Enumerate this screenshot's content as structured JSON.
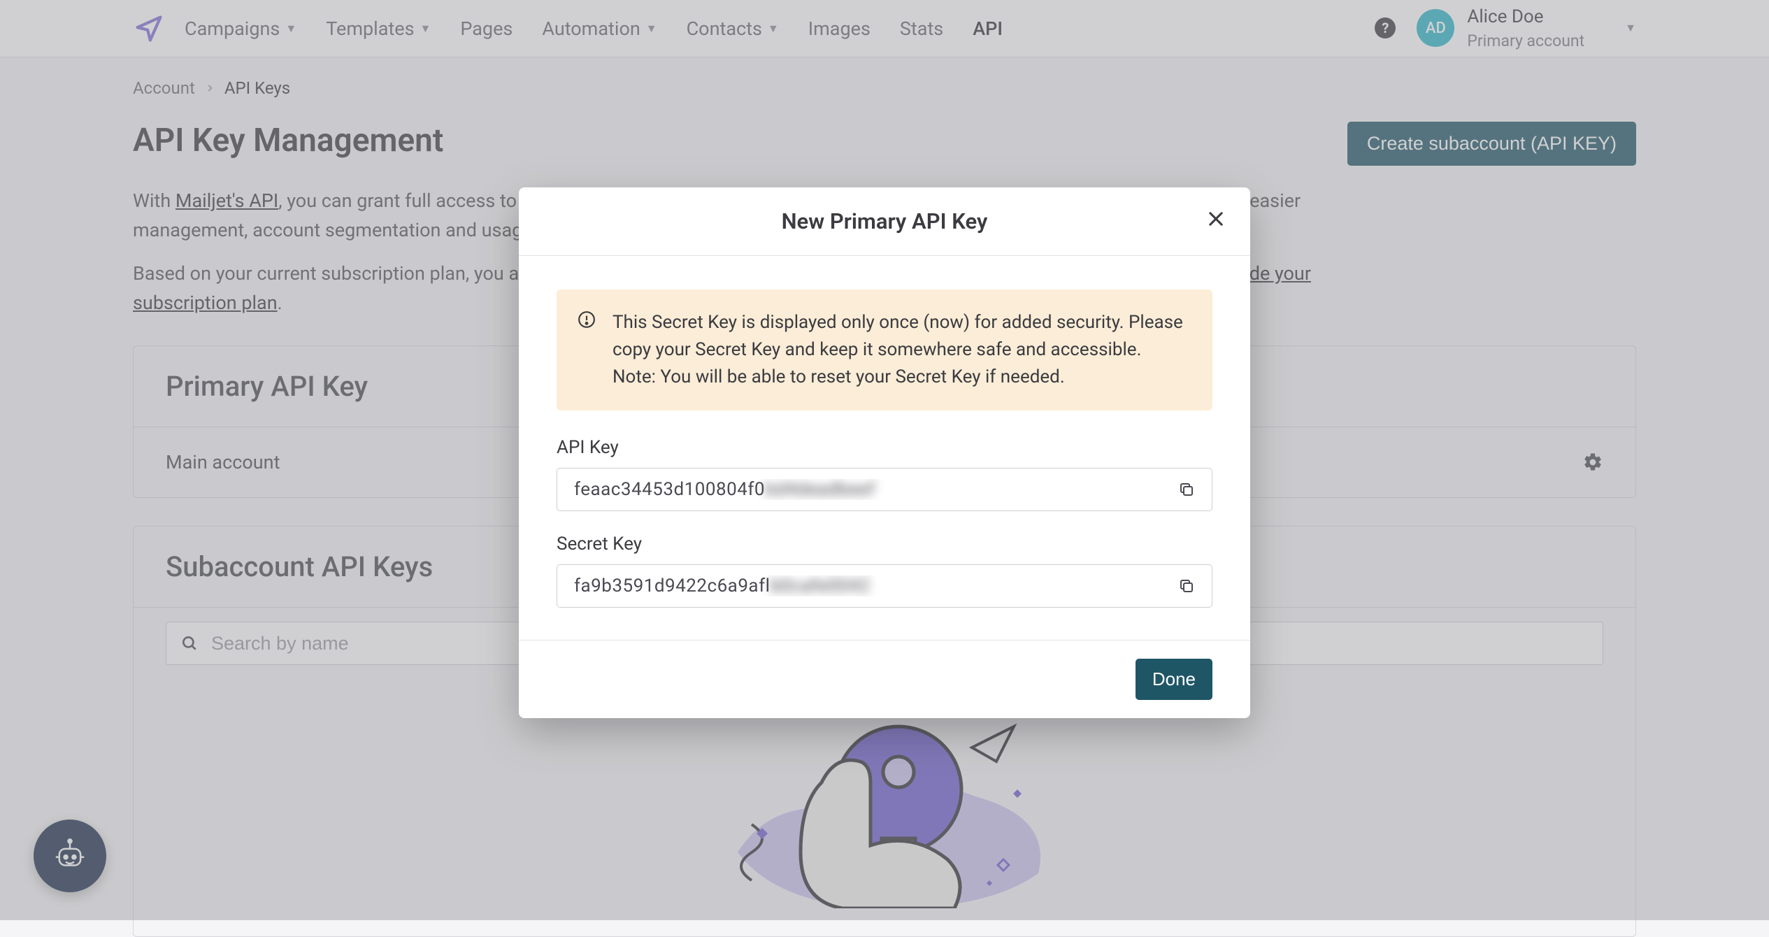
{
  "nav": {
    "items": [
      {
        "label": "Campaigns",
        "caret": true
      },
      {
        "label": "Templates",
        "caret": true
      },
      {
        "label": "Pages",
        "caret": false
      },
      {
        "label": "Automation",
        "caret": true
      },
      {
        "label": "Contacts",
        "caret": true
      },
      {
        "label": "Images",
        "caret": false
      },
      {
        "label": "Stats",
        "caret": false
      },
      {
        "label": "API",
        "caret": false,
        "active": true
      }
    ]
  },
  "account": {
    "initials": "AD",
    "name": "Alice Doe",
    "subtitle": "Primary account"
  },
  "breadcrumb": {
    "root": "Account",
    "current": "API Keys"
  },
  "header": {
    "title": "API Key Management",
    "button": "Create subaccount (API KEY)"
  },
  "intro": {
    "p1_prefix": "With ",
    "p1_link": "Mailjet's API",
    "p1_suffix": ", you can grant full access to your account via the Primary API Key, or create subaccounts with different API keys for easier management, account segmentation and usage tracking.",
    "p2_prefix": "Based on your current subscription plan, you are able to create up to a certain number of subaccounts. If you need more, please ",
    "p2_link": "upgrade your subscription plan",
    "p2_suffix": "."
  },
  "primary": {
    "heading": "Primary API Key",
    "row": "Main account"
  },
  "sub": {
    "heading": "Subaccount API Keys",
    "search_placeholder": "Search by name"
  },
  "modal": {
    "title": "New Primary API Key",
    "alert_l1": "This Secret Key is displayed only once (now) for added security. Please copy your Secret Key and keep it somewhere safe and accessible.",
    "alert_l2": "Note: You will be able to reset your Secret Key if needed.",
    "api_label": "API Key",
    "api_visible": "feaac34453d100804f0",
    "api_blurred": "bd4deadbeef",
    "secret_label": "Secret Key",
    "secret_visible": "fa9b3591d9422c6a9afl",
    "secret_blurred": "b0cafe0042",
    "done": "Done"
  }
}
